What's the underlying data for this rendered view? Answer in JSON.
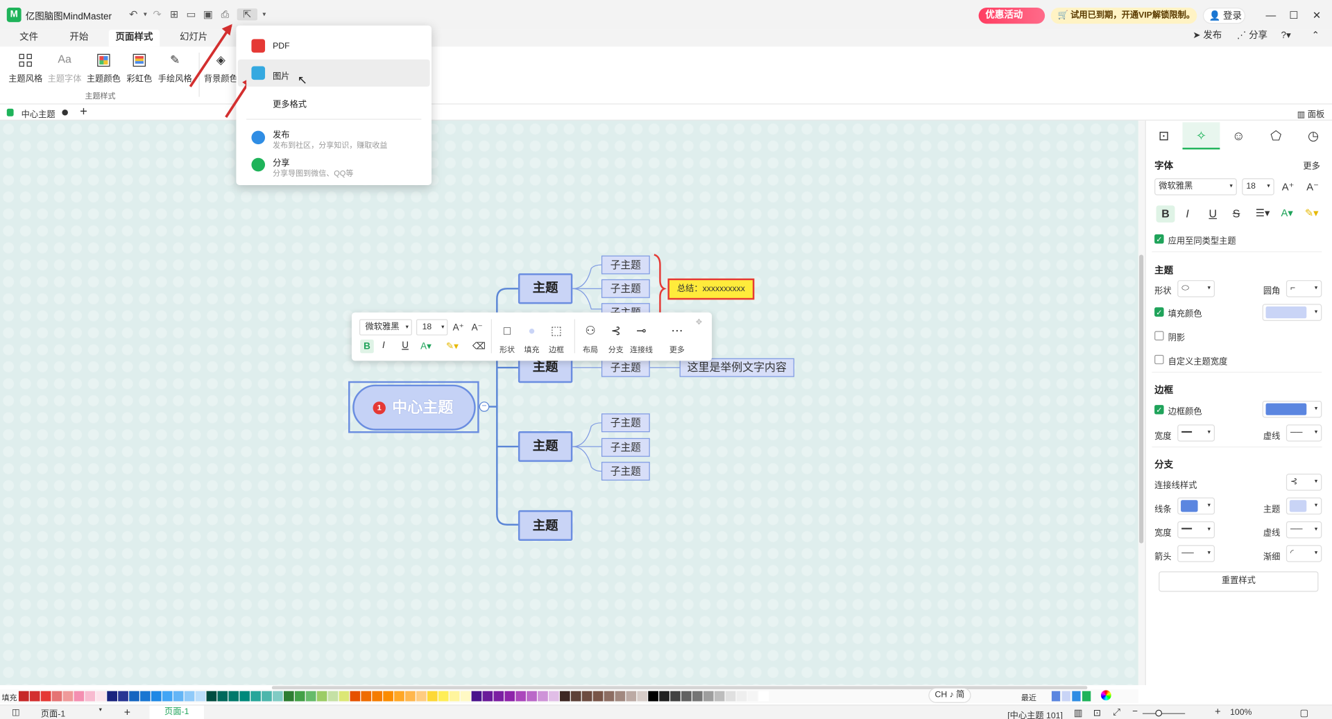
{
  "app": {
    "title": "亿图脑图MindMaster",
    "promo_label": "优惠活动",
    "vip_notice": "试用已到期，开通VIP解锁限制。",
    "login_label": "登录",
    "publish_label": "发布",
    "share_label": "分享"
  },
  "menus": [
    "文件",
    "开始",
    "页面样式",
    "幻灯片"
  ],
  "ribbon": {
    "buttons": [
      {
        "label": "主题风格",
        "icon": "grid-icon"
      },
      {
        "label": "主题字体",
        "icon": "font-icon"
      },
      {
        "label": "主题颜色",
        "icon": "palette-icon"
      },
      {
        "label": "彩虹色",
        "icon": "rainbow-icon"
      },
      {
        "label": "手绘风格",
        "icon": "pen-icon"
      },
      {
        "label": "背景颜色",
        "icon": "paint-bucket-icon"
      }
    ],
    "group_label": "主题样式"
  },
  "doc_tab": {
    "label": "中心主题",
    "add": "+"
  },
  "dropdown": {
    "pdf": "PDF",
    "image": "图片",
    "more": "更多格式",
    "publish_title": "发布",
    "publish_desc": "发布到社区，分享知识，赚取收益",
    "share_title": "分享",
    "share_desc": "分享导图到微信、QQ等"
  },
  "mindmap": {
    "central": "中心主题",
    "central_badge": "1",
    "topic": "主题",
    "subtopic": "子主题",
    "summary": "总结：xxxxxxxxxx",
    "example_text": "这里是举例文字内容"
  },
  "float_toolbar": {
    "font": "微软雅黑",
    "size": "18",
    "tools": [
      "形状",
      "填充",
      "边框",
      "布局",
      "分支",
      "连接线",
      "更多"
    ]
  },
  "right_panel": {
    "font_section": "字体",
    "more": "更多",
    "font_name": "微软雅黑",
    "font_size": "18",
    "apply_same": "应用至同类型主题",
    "topic_section": "主题",
    "shape_label": "形状",
    "corner_label": "圆角",
    "fill_label": "填充颜色",
    "shadow_label": "阴影",
    "custom_width_label": "自定义主题宽度",
    "border_section": "边框",
    "border_color_label": "边框颜色",
    "width_label": "宽度",
    "dash_label": "虚线",
    "branch_section": "分支",
    "connector_style_label": "连接线样式",
    "line_label": "线条",
    "theme_label": "主题",
    "arrow_label": "箭头",
    "taper_label": "渐细",
    "reset_label": "重置样式",
    "panel_label": "面板"
  },
  "statusbar": {
    "fill_label": "填充",
    "recent_label": "最近",
    "page_select": "页面-1",
    "page_tab": "页面-1",
    "selection_info": "[中心主题 101]",
    "zoom": "100%",
    "ime": "CH ♪ 简"
  },
  "colors": {
    "accent_green": "#1fb35a",
    "node_fill": "#c9d4f6",
    "node_border": "#6a8de0",
    "summary_fill": "#ffeb3b",
    "summary_border": "#e53935",
    "arrow": "#d32f2f"
  }
}
